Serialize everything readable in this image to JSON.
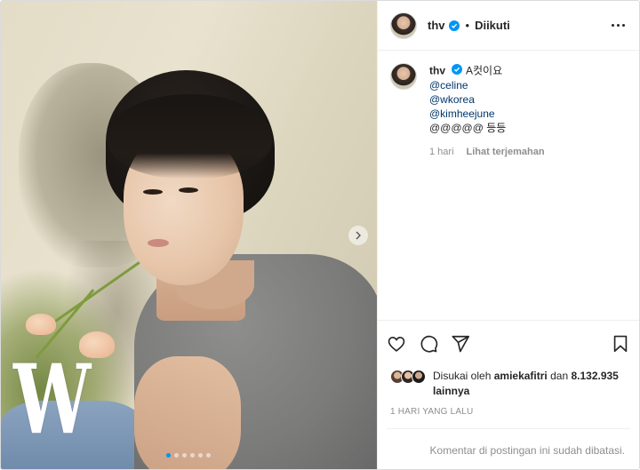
{
  "post": {
    "username": "thv",
    "follow_status": "Diikuti",
    "separator": "•",
    "verified_icon": "verified-badge-icon",
    "more_icon": "more-options-icon",
    "colors": {
      "verified": "#0095f6",
      "link": "#00376b",
      "muted": "#8e8e8e",
      "text": "#262626"
    }
  },
  "media": {
    "overlay_logo": "W",
    "carousel": {
      "total": 6,
      "current": 1
    },
    "next_icon": "chevron-right-icon"
  },
  "caption": {
    "username": "thv",
    "text": "A컷이요",
    "mentions": [
      "@celine",
      "@wkorea",
      "@kimheejune"
    ],
    "last_line": "@@@@@ 등등",
    "time": "1 hari",
    "translate_label": "Lihat terjemahan"
  },
  "actions": {
    "like_icon": "heart-icon",
    "comment_icon": "comment-icon",
    "share_icon": "share-icon",
    "save_icon": "bookmark-icon"
  },
  "likes": {
    "prefix": "Disukai oleh",
    "user": "amiekafitri",
    "middle": "dan",
    "count": "8.132.935",
    "suffix": "lainnya"
  },
  "timestamp": "1 HARI YANG LALU",
  "comments_disabled": "Komentar di postingan ini sudah dibatasi."
}
